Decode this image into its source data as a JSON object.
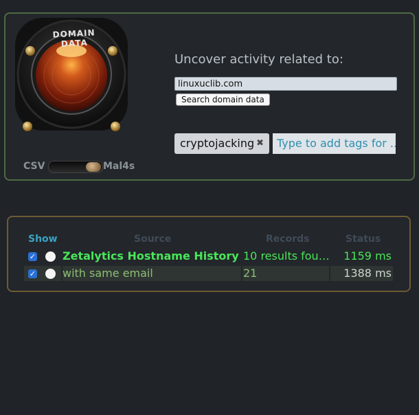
{
  "gauge": {
    "title": "DOMAIN DATA"
  },
  "toggle": {
    "left_label": "CSV",
    "right_label": "Mal4s",
    "selected": "Mal4s"
  },
  "search": {
    "headline": "Uncover activity related to:",
    "domain_value": "linuxuclib.com",
    "button_label": "Search domain data"
  },
  "tags": {
    "items": [
      {
        "label": "cryptojacking",
        "remove_glyph": "✖"
      }
    ],
    "placeholder": "Type to add tags for ..."
  },
  "results": {
    "headers": {
      "show": "Show",
      "source": "Source",
      "records": "Records",
      "status": "Status"
    },
    "rows": [
      {
        "checked": true,
        "source": "Zetalytics Hostname History",
        "records": "10 results fou…",
        "status": "1159 ms"
      },
      {
        "checked": true,
        "source": "with same email",
        "records": "21",
        "status": "1388 ms"
      }
    ]
  },
  "colors": {
    "panel_top_border": "#4e6a45",
    "panel_bottom_border": "#6e5b34",
    "success_green": "#48e65a",
    "show_header_blue": "#3aa3c4"
  }
}
